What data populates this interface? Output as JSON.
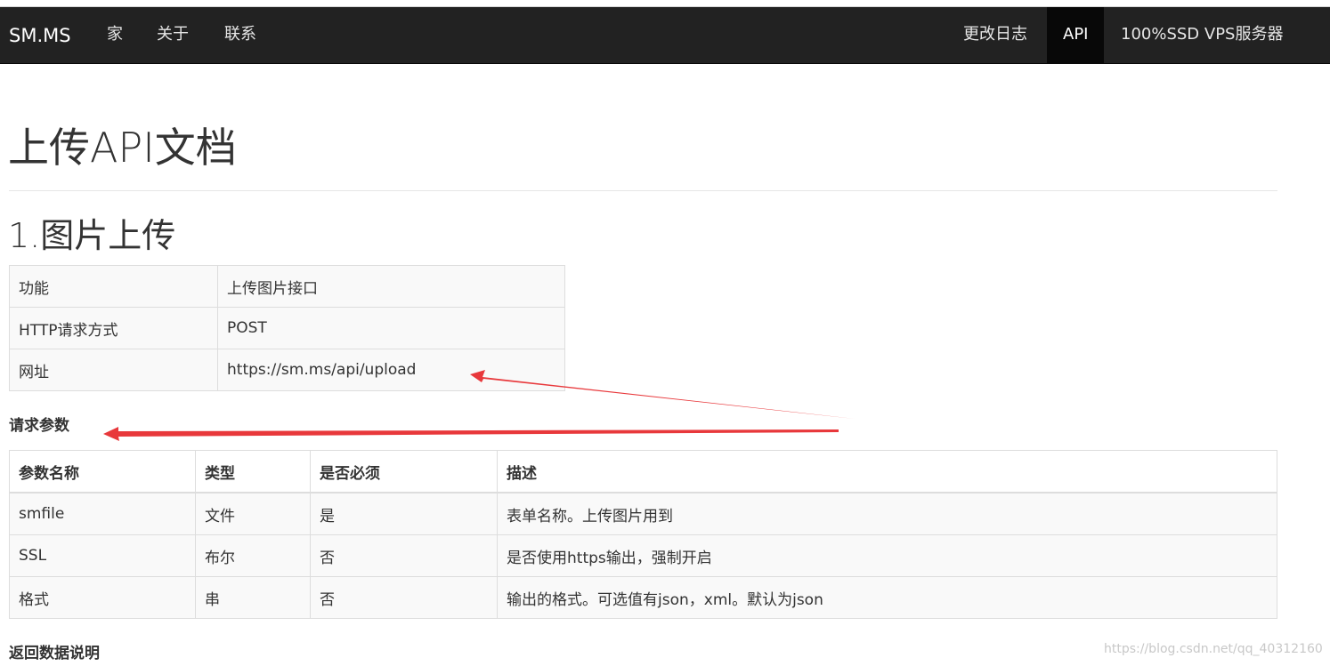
{
  "nav": {
    "brand": "SM.MS",
    "left_items": [
      "家",
      "关于",
      "联系"
    ],
    "right_items": [
      "更改日志",
      "API",
      "100%SSD VPS服务器"
    ],
    "active_item": "API",
    "bg_color": "#222222"
  },
  "page": {
    "title": "上传API文档",
    "section_title": "1.图片上传"
  },
  "info_table": {
    "rows": [
      [
        "功能",
        "上传图片接口"
      ],
      [
        "HTTP请求方式",
        "POST"
      ],
      [
        "网址",
        "https://sm.ms/api/upload"
      ]
    ]
  },
  "params": {
    "heading": "请求参数",
    "columns": [
      "参数名称",
      "类型",
      "是否必须",
      "描述"
    ],
    "rows": [
      [
        "smfile",
        "文件",
        "是",
        "表单名称。上传图片用到"
      ],
      [
        "SSL",
        "布尔",
        "否",
        "是否使用https输出，强制开启"
      ],
      [
        "格式",
        "串",
        "否",
        "输出的格式。可选值有json，xml。默认为json"
      ]
    ]
  },
  "return_heading": "返回数据说明",
  "watermark": "https://blog.csdn.net/qq_40312160",
  "annotation_color": "#e8383b"
}
